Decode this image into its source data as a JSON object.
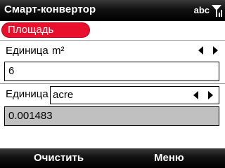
{
  "titlebar": {
    "title": "Смарт-конвертор",
    "input_mode": "abc",
    "signal_icon": "signal-bars-icon"
  },
  "category": {
    "label": "Площадь",
    "color": "#e8102a"
  },
  "from": {
    "unit_label": "Единица",
    "unit_value": "m²",
    "input_value": "6"
  },
  "to": {
    "unit_label": "Единица",
    "unit_value": "acre",
    "result_value": "0.001483"
  },
  "softkeys": {
    "left": "Очистить",
    "right": "Меню"
  },
  "colors": {
    "bar_background": "#000000",
    "accent": "#e8102a",
    "result_field": "#c0c0c0"
  }
}
